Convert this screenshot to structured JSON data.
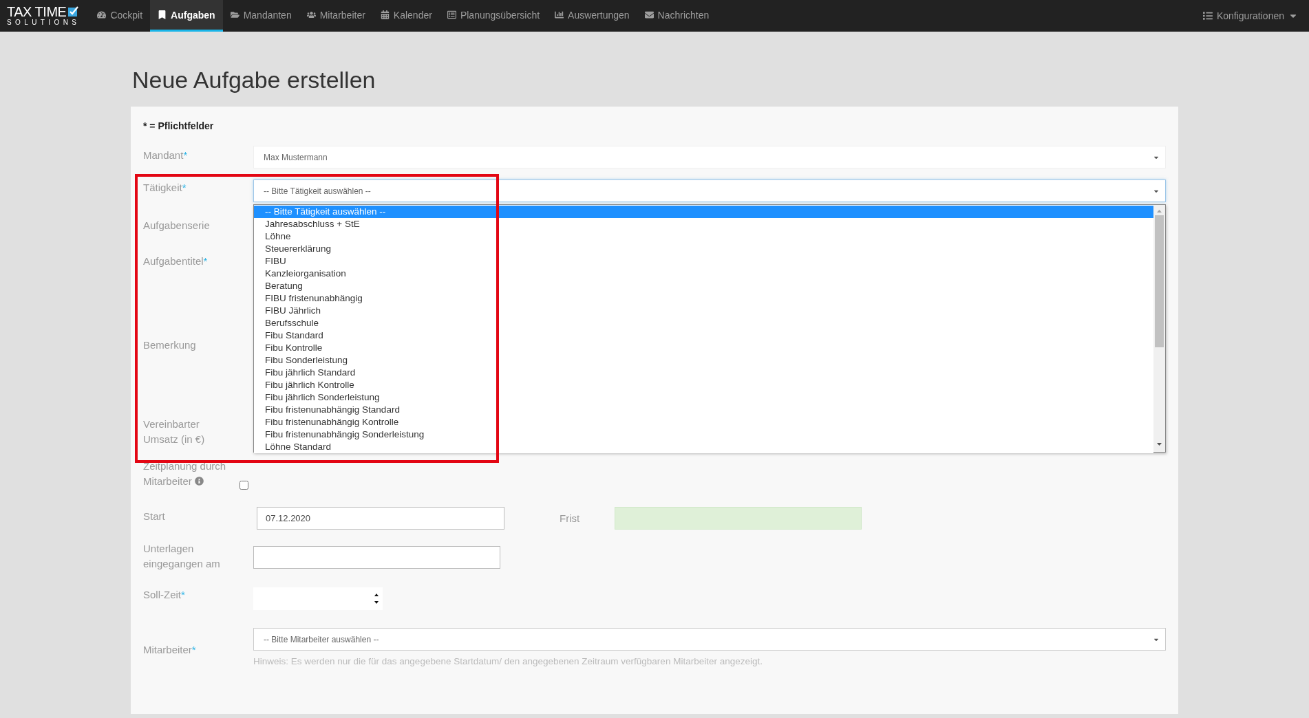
{
  "nav": {
    "logo_title": "TAX TIME",
    "logo_subtitle": "SOLUTIONS",
    "items": [
      {
        "kind": "cockpit",
        "label": "Cockpit",
        "selected": false
      },
      {
        "kind": "tasks",
        "label": "Aufgaben",
        "selected": true
      },
      {
        "kind": "clients",
        "label": "Mandanten",
        "selected": false
      },
      {
        "kind": "staff",
        "label": "Mitarbeiter",
        "selected": false
      },
      {
        "kind": "calendar",
        "label": "Kalender",
        "selected": false
      },
      {
        "kind": "planning",
        "label": "Planungsübersicht",
        "selected": false
      },
      {
        "kind": "reports",
        "label": "Auswertungen",
        "selected": false
      },
      {
        "kind": "messages",
        "label": "Nachrichten",
        "selected": false
      }
    ],
    "config": "Konfigurationen"
  },
  "page_title": "Neue Aufgabe erstellen",
  "form": {
    "required_note": "* = Pflichtfelder",
    "mandant": {
      "label": "Mandant",
      "required_mark": "*",
      "value": "Max Mustermann"
    },
    "taetigkeit": {
      "label": "Tätigkeit",
      "required_mark": "*",
      "value": "-- Bitte Tätigkeit auswählen --",
      "expanded": true,
      "options": [
        {
          "label": "-- Bitte Tätigkeit auswählen --",
          "selected": true
        },
        {
          "label": "Jahresabschluss + StE",
          "selected": false
        },
        {
          "label": "Löhne",
          "selected": false
        },
        {
          "label": "Steuererklärung",
          "selected": false
        },
        {
          "label": "FIBU",
          "selected": false
        },
        {
          "label": "Kanzleiorganisation",
          "selected": false
        },
        {
          "label": "Beratung",
          "selected": false
        },
        {
          "label": "FIBU fristenunabhängig",
          "selected": false
        },
        {
          "label": "FIBU Jährlich",
          "selected": false
        },
        {
          "label": "Berufsschule",
          "selected": false
        },
        {
          "label": "Fibu Standard",
          "selected": false
        },
        {
          "label": "Fibu Kontrolle",
          "selected": false
        },
        {
          "label": "Fibu Sonderleistung",
          "selected": false
        },
        {
          "label": "Fibu jährlich Standard",
          "selected": false
        },
        {
          "label": "Fibu jährlich Kontrolle",
          "selected": false
        },
        {
          "label": "Fibu jährlich Sonderleistung",
          "selected": false
        },
        {
          "label": "Fibu fristenunabhängig Standard",
          "selected": false
        },
        {
          "label": "Fibu fristenunabhängig Kontrolle",
          "selected": false
        },
        {
          "label": "Fibu fristenunabhängig Sonderleistung",
          "selected": false
        },
        {
          "label": "Löhne Standard",
          "selected": false
        }
      ]
    },
    "aufgabenserie": {
      "label": "Aufgabenserie"
    },
    "aufgabentitel": {
      "label": "Aufgabentitel",
      "required_mark": "*"
    },
    "bemerkung": {
      "label": "Bemerkung"
    },
    "umsatz": {
      "label": "Vereinbarter Umsatz (in €)"
    },
    "zeitplanung": {
      "label": "Zeitplanung durch Mitarbeiter",
      "checked": false
    },
    "start": {
      "label": "Start",
      "value": "07.12.2020"
    },
    "frist": {
      "label": "Frist"
    },
    "unterlagen": {
      "label": "Unterlagen eingegangen am"
    },
    "soll_zeit": {
      "label": "Soll-Zeit",
      "required_mark": "*"
    },
    "mitarbeiter": {
      "label": "Mitarbeiter",
      "required_mark": "*",
      "value": "-- Bitte Mitarbeiter auswählen --",
      "hint": "Hinweis: Es werden nur die für das angegebene Startdatum/ den angegebenen Zeitraum verfügbaren Mitarbeiter angezeigt."
    }
  }
}
